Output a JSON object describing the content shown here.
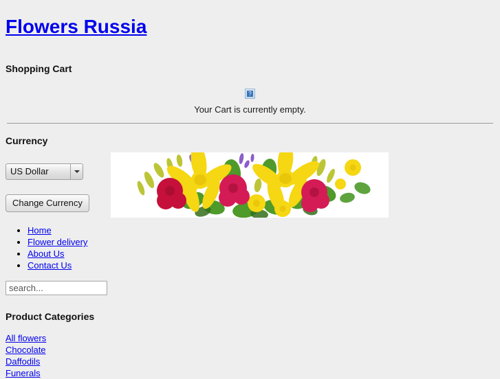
{
  "site": {
    "title": "Flowers Russia"
  },
  "cart": {
    "heading": "Shopping Cart",
    "icon": "broken-image-icon",
    "icon_glyph": "?",
    "empty_text": "Your Cart is currently empty."
  },
  "currency": {
    "heading": "Currency",
    "selected": "US Dollar",
    "options": [
      "US Dollar"
    ],
    "dropdown_icon": "chevron-down-icon",
    "change_button": "Change Currency"
  },
  "banner": {
    "alt": "Flower bouquet with yellow lilies and red carnations",
    "colors": {
      "background": "#ffffff",
      "lily_yellow": "#f5d713",
      "lily_yellow_dark": "#e0b806",
      "carnation_red": "#c5103b",
      "carnation_pink": "#d41b56",
      "leaf_green": "#4e9a2a",
      "leaf_green_dark": "#356f1c",
      "filler_yellow_green": "#b9c22c",
      "accent_purple": "#8b5ec9"
    }
  },
  "nav": {
    "items": [
      {
        "label": "Home"
      },
      {
        "label": "Flower delivery"
      },
      {
        "label": "About Us"
      },
      {
        "label": "Contact Us"
      }
    ]
  },
  "search": {
    "value": "",
    "placeholder": "search..."
  },
  "categories": {
    "heading": "Product Categories",
    "items": [
      {
        "label": "All flowers"
      },
      {
        "label": "Chocolate"
      },
      {
        "label": "Daffodils"
      },
      {
        "label": "Funerals"
      }
    ]
  },
  "theme": {
    "page_background": "#eeeeee",
    "link_color": "#0000ee",
    "text_color": "#000000",
    "rule_color": "#9a9a9a"
  }
}
